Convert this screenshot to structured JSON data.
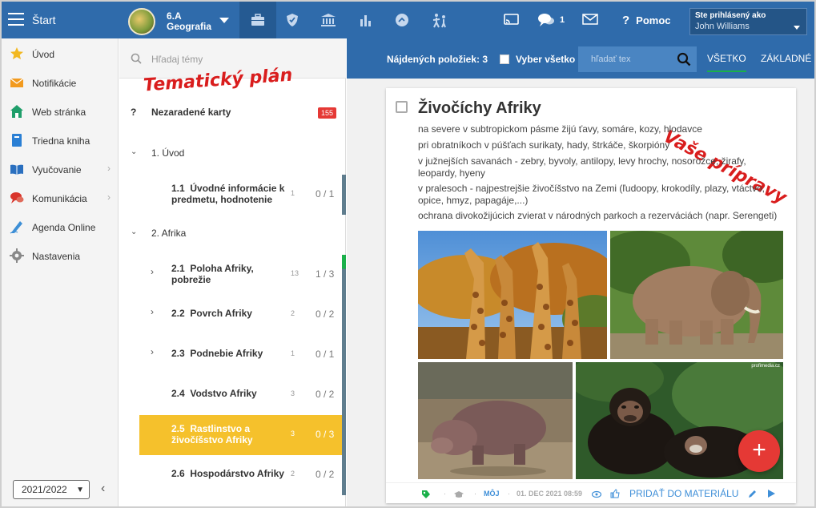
{
  "topbar": {
    "start_label": "Štart",
    "class_line1": "6.A",
    "class_line2": "Geografia",
    "messages_count": "1",
    "help_label": "Pomoc",
    "logged_label": "Ste prihlásený ako",
    "user_name": "John Williams"
  },
  "sidebar": {
    "items": [
      {
        "label": "Úvod",
        "icon": "star-icon"
      },
      {
        "label": "Notifikácie",
        "icon": "envelope-icon"
      },
      {
        "label": "Web stránka",
        "icon": "house-icon"
      },
      {
        "label": "Triedna kniha",
        "icon": "book-icon"
      },
      {
        "label": "Vyučovanie",
        "icon": "open-book-icon"
      },
      {
        "label": "Komunikácia",
        "icon": "chat-icon"
      },
      {
        "label": "Agenda Online",
        "icon": "pen-icon"
      },
      {
        "label": "Nastavenia",
        "icon": "gear-icon"
      }
    ],
    "year": "2021/2022"
  },
  "topics_panel": {
    "search_placeholder": "Hľadaj témy",
    "annotation": "Tematický plán",
    "unassigned_mark": "?",
    "unassigned_label": "Nezaradené karty",
    "unassigned_count": "155",
    "chapters": [
      {
        "label": "1. Úvod"
      },
      {
        "label": "2. Afrika"
      }
    ],
    "topics": [
      {
        "num": "1.1",
        "title": "Úvodné informácie k predmetu, hodnotenie",
        "count": "1",
        "frac": "0 / 1"
      },
      {
        "num": "2.1",
        "title": "Poloha Afriky, pobrežie",
        "count": "13",
        "frac": "1 / 3"
      },
      {
        "num": "2.2",
        "title": "Povrch Afriky",
        "count": "2",
        "frac": "0 / 2"
      },
      {
        "num": "2.3",
        "title": "Podnebie Afriky",
        "count": "1",
        "frac": "0 / 1"
      },
      {
        "num": "2.4",
        "title": "Vodstvo Afriky",
        "count": "3",
        "frac": "0 / 2"
      },
      {
        "num": "2.5",
        "title": "Rastlinstvo a živočíšstvo Afriky",
        "count": "3",
        "frac": "0 / 3"
      },
      {
        "num": "2.6",
        "title": "Hospodárstvo Afriky",
        "count": "2",
        "frac": "0 / 2"
      }
    ]
  },
  "materials_panel": {
    "found_label": "Nájdených položiek: 3",
    "select_all_label": "Vyber všetko",
    "filter_placeholder": "hľadať tex",
    "tab_all": "VŠETKO",
    "tab_basic": "ZÁKLADNÉ",
    "annotation": "Vaše prípravy",
    "card": {
      "title": "Živočíchy Afriky",
      "lines": [
        "na severe v subtropickom pásme žijú ťavy, somáre, kozy, hlodavce",
        "pri obratníkoch v púšťach surikaty, hady, štrkáče, škorpióny",
        "v južnejších savanách - zebry, byvoly, antilopy, levy hrochy, nosorožce, žirafy, leopardy, hyeny",
        "v pralesoch - najpestrejšie živočíšstvo na Zemi (ľudoopy, krokodíly, plazy, vtáctvo, opice, hmyz, papagáje,...)",
        "ochrana divokožijúcich zvierat v národných parkoch a rezerváciách (napr. Serengeti)"
      ],
      "watermark": "profimedia.cz",
      "owner_label": "MÔJ",
      "date": "01. DEC 2021 08:59",
      "add_label": "PRIDAŤ DO MATERIÁLU"
    }
  },
  "colors": {
    "brand": "#2f6bab",
    "selected": "#f5c12c",
    "badge": "#e53935",
    "accent_green": "#1ab04a"
  }
}
